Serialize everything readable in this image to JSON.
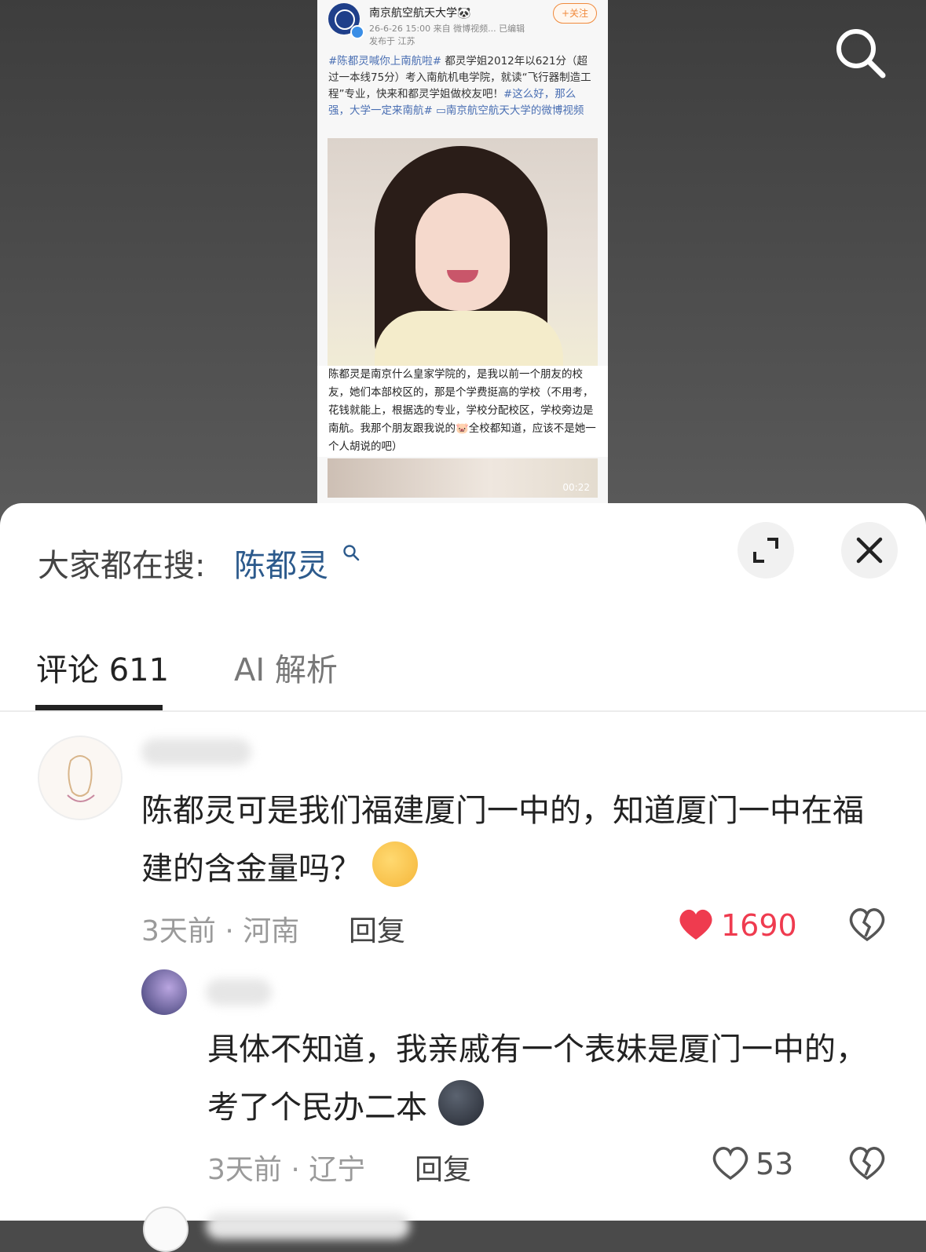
{
  "post": {
    "account_name": "南京航空航天大学🐼",
    "meta": "26-6-26 15:00  来自 微博视频...  已编辑",
    "location": "发布于 江苏",
    "follow_label": "+关注",
    "text_tag1": "#陈都灵喊你上南航啦#",
    "text_body": " 都灵学姐2012年以621分（超过一本线75分）考入南航机电学院，就读“飞行器制造工程”专业，快来和都灵学姐做校友吧！",
    "text_tag2": "#这么好，那么强，大学一定来南航#",
    "text_link": " ▭南京航空航天大学的微博视频",
    "overlay_caption": "陈都灵是南京什么皇家学院的，是我以前一个朋友的校友，她们本部校区的，那是个学费挺高的学校（不用考，花钱就能上，根据选的专业，学校分配校区，学校旁边是南航。我那个朋友跟我说的🐷全校都知道，应该不是她一个人胡说的吧）",
    "duration": "00:22"
  },
  "sheet": {
    "hot_search_label": "大家都在搜:",
    "hot_search_term": "陈都灵",
    "tabs": [
      {
        "label": "评论 611"
      },
      {
        "label": "AI 解析"
      }
    ]
  },
  "comments": [
    {
      "text": "陈都灵可是我们福建厦门一中的，知道厦门一中在福建的含金量吗？",
      "meta": "3天前 · 河南",
      "reply_label": "回复",
      "likes": "1690"
    },
    {
      "text": "具体不知道，我亲戚有一个表妹是厦门一中的，考了个民办二本",
      "meta": "3天前 · 辽宁",
      "reply_label": "回复",
      "likes": "53"
    }
  ],
  "icons": [
    "search-icon",
    "expand-icon",
    "close-icon",
    "heart-filled-icon",
    "heart-outline-icon",
    "dislike-icon"
  ],
  "colors": {
    "link_blue": "#2c5a8c",
    "like_red": "#ef3b4f"
  }
}
